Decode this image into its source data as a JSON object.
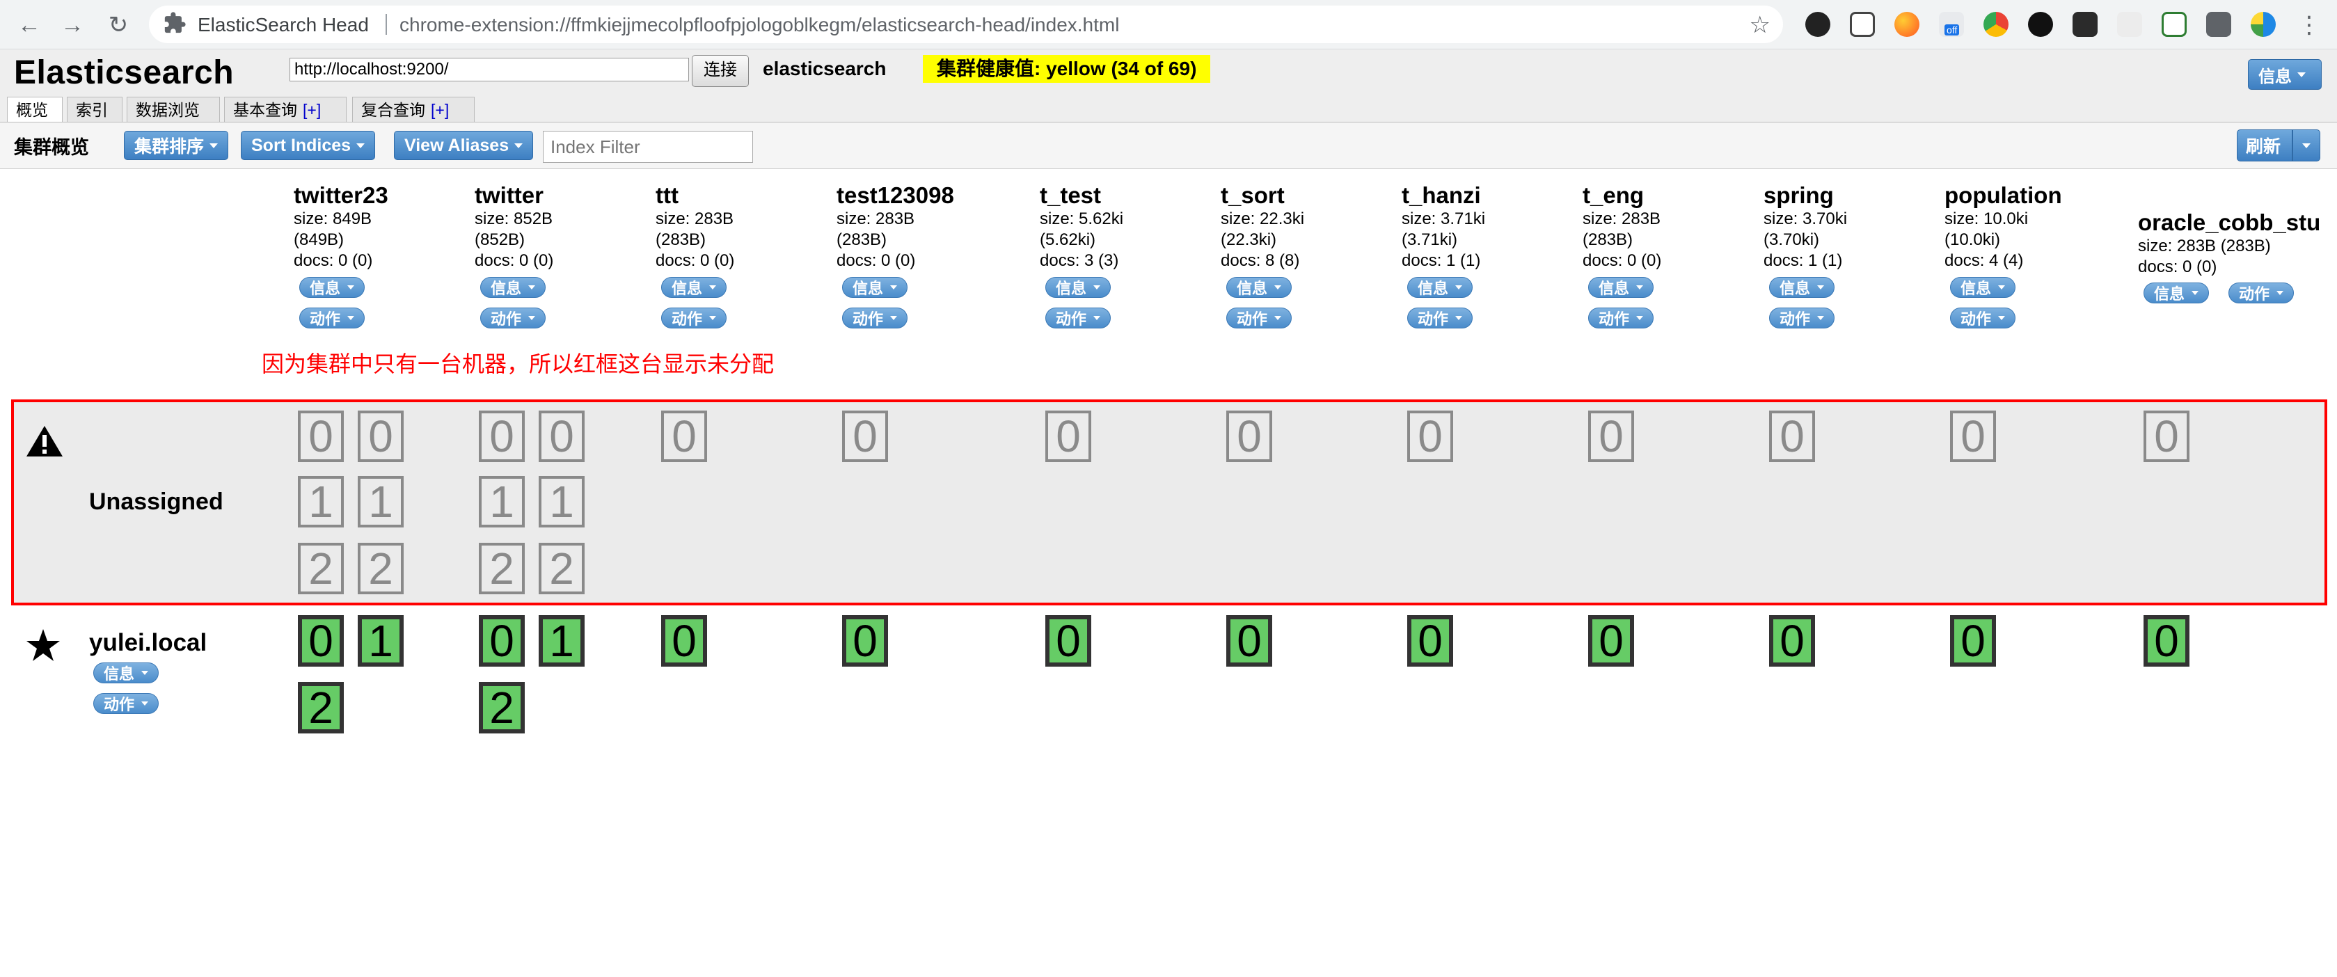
{
  "browser": {
    "tab_title": "ElasticSearch Head",
    "url": "chrome-extension://ffmkiejjmecolpfloofpjologoblkegm/elasticsearch-head/index.html",
    "extension_badge": "off"
  },
  "header": {
    "logo": "Elasticsearch",
    "connect_url": "http://localhost:9200/",
    "connect_label": "连接",
    "cluster_name": "elasticsearch",
    "health_text": "集群健康值: yellow (34 of 69)",
    "info_label": "信息",
    "health_color": "#ffff00"
  },
  "tabs": [
    {
      "label": "概览",
      "active": true
    },
    {
      "label": "索引"
    },
    {
      "label": "数据浏览"
    },
    {
      "label": "基本查询",
      "plus": "[+]"
    },
    {
      "label": "复合查询",
      "plus": "[+]"
    }
  ],
  "toolbar": {
    "title": "集群概览",
    "sort_cluster": "集群排序",
    "sort_indices": "Sort Indices",
    "view_aliases": "View Aliases",
    "filter_placeholder": "Index Filter",
    "refresh": "刷新"
  },
  "index_actions": {
    "info": "信息",
    "action": "动作"
  },
  "indices": [
    {
      "name": "twitter23",
      "size": "size: 849B",
      "size2": "(849B)",
      "docs": "docs: 0 (0)"
    },
    {
      "name": "twitter",
      "size": "size: 852B",
      "size2": "(852B)",
      "docs": "docs: 0 (0)"
    },
    {
      "name": "ttt",
      "size": "size: 283B",
      "size2": "(283B)",
      "docs": "docs: 0 (0)"
    },
    {
      "name": "test123098",
      "size": "size: 283B",
      "size2": "(283B)",
      "docs": "docs: 0 (0)"
    },
    {
      "name": "t_test",
      "size": "size: 5.62ki",
      "size2": "(5.62ki)",
      "docs": "docs: 3 (3)"
    },
    {
      "name": "t_sort",
      "size": "size: 22.3ki",
      "size2": "(22.3ki)",
      "docs": "docs: 8 (8)"
    },
    {
      "name": "t_hanzi",
      "size": "size: 3.71ki",
      "size2": "(3.71ki)",
      "docs": "docs: 1 (1)"
    },
    {
      "name": "t_eng",
      "size": "size: 283B",
      "size2": "(283B)",
      "docs": "docs: 0 (0)"
    },
    {
      "name": "spring",
      "size": "size: 3.70ki",
      "size2": "(3.70ki)",
      "docs": "docs: 1 (1)"
    },
    {
      "name": "population",
      "size": "size: 10.0ki",
      "size2": "(10.0ki)",
      "docs": "docs: 4 (4)"
    },
    {
      "name": "oracle_cobb_stu",
      "size": "size: 283B (283B)",
      "docs": "docs: 0 (0)"
    }
  ],
  "annotation": "因为集群中只有一台机器，所以红框这台显示未分配",
  "unassigned": {
    "label": "Unassigned",
    "shard_numbers": [
      "0",
      "1",
      "2"
    ]
  },
  "node": {
    "name": "yulei.local",
    "info": "信息",
    "action": "动作"
  },
  "colors": {
    "unassigned_border": "#ff0000",
    "shard_started": "#66cc66",
    "button_blue": "#4a8ccb",
    "annotation_text": "#ff0000"
  }
}
